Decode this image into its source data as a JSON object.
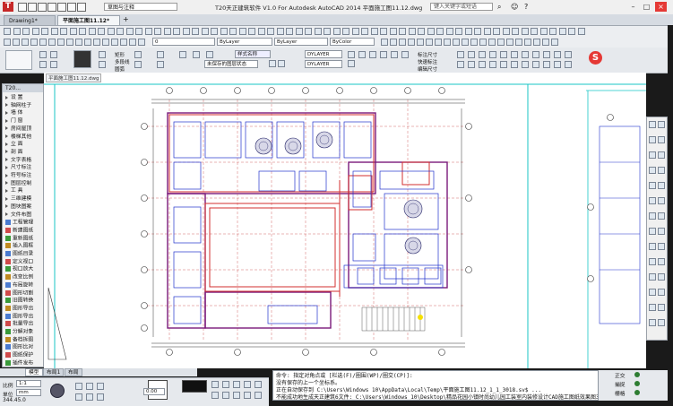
{
  "app": {
    "title": "T20天正建筑软件 V1.0 For Autodesk AutoCAD 2014     平面施工图11.12.dwg",
    "workspace": "草图与注释",
    "search_placeholder": "键入关键字或短语",
    "brand_color": "#c62828"
  },
  "doc_tabs": [
    {
      "label": "Drawing1*",
      "active": false
    },
    {
      "label": "平面施工图11.12*",
      "active": true
    }
  ],
  "toolbar": {
    "layer_name": "0",
    "linetype": "ByLayer",
    "lineweight": "ByLayer",
    "color": "ByColor",
    "style_combo": "样式名称",
    "dim_style_1": "DYLAYER",
    "dim_style_2": "DYLAYER",
    "layer_state": "未保存的图层状态"
  },
  "ribbon": {
    "labels": [
      "矩形",
      "多段线",
      "圆弧",
      "修剪",
      "延伸",
      "复制",
      "镜像",
      "缩放"
    ],
    "right_labels": [
      "标注尺寸",
      "快速标注",
      "编辑尺寸"
    ]
  },
  "viewport": {
    "label": "平面施工图11.12.dwg"
  },
  "sidebar": {
    "header": "T20...",
    "items": [
      {
        "label": "设  置",
        "kind": "arrow"
      },
      {
        "label": "轴网柱子",
        "kind": "arrow"
      },
      {
        "label": "墙  体",
        "kind": "arrow"
      },
      {
        "label": "门  窗",
        "kind": "arrow"
      },
      {
        "label": "房间屋顶",
        "kind": "arrow"
      },
      {
        "label": "楼梯其他",
        "kind": "arrow"
      },
      {
        "label": "立  面",
        "kind": "arrow"
      },
      {
        "label": "剖  面",
        "kind": "arrow"
      },
      {
        "label": "文字表格",
        "kind": "arrow"
      },
      {
        "label": "尺寸标注",
        "kind": "arrow"
      },
      {
        "label": "符号标注",
        "kind": "arrow"
      },
      {
        "label": "图层控制",
        "kind": "arrow"
      },
      {
        "label": "工  具",
        "kind": "arrow"
      },
      {
        "label": "三维建模",
        "kind": "arrow"
      },
      {
        "label": "图块图案",
        "kind": "arrow"
      },
      {
        "label": "文件布图",
        "kind": "arrow"
      },
      {
        "label": "工程管理",
        "kind": "icon"
      },
      {
        "label": "新建图纸",
        "kind": "icon"
      },
      {
        "label": "重新图纸",
        "kind": "icon"
      },
      {
        "label": "插入图框",
        "kind": "icon"
      },
      {
        "label": "图纸目录",
        "kind": "icon"
      },
      {
        "label": "定义视口",
        "kind": "icon"
      },
      {
        "label": "视口放大",
        "kind": "icon"
      },
      {
        "label": "改变比例",
        "kind": "icon"
      },
      {
        "label": "布局旋转",
        "kind": "icon"
      },
      {
        "label": "图形切割",
        "kind": "icon"
      },
      {
        "label": "旧图转换",
        "kind": "icon"
      },
      {
        "label": "图形导出",
        "kind": "icon"
      },
      {
        "label": "图形导出",
        "kind": "icon"
      },
      {
        "label": "批量导出",
        "kind": "icon"
      },
      {
        "label": "分解对象",
        "kind": "icon"
      },
      {
        "label": "备档拆图",
        "kind": "icon"
      },
      {
        "label": "图形比对",
        "kind": "icon"
      },
      {
        "label": "图纸保护",
        "kind": "icon"
      },
      {
        "label": "插件发布",
        "kind": "icon"
      }
    ]
  },
  "layout_tabs": [
    {
      "label": "模型",
      "active": true
    },
    {
      "label": "布局1",
      "active": false
    },
    {
      "label": "布局",
      "active": false
    }
  ],
  "status": {
    "scale_label": "比例",
    "scale_value": "1:1",
    "unit_label": "单位",
    "unit_value": "mm",
    "elev_value": "0.00",
    "coord": "344.45.0",
    "right_labels": [
      "正交",
      "捕捉",
      "栅格"
    ]
  },
  "command": {
    "lines": [
      "命令: 指定对角点或 [栏选(F)/圈围(WP)/圈交(CP)]:",
      "没有保存的上一个坐标系。",
      "正在自动保存到 C:\\Users\\Windows 10\\AppData\\Local\\Temp\\平面施工图11.12_1_1_3018.sv$ ...",
      "不能成功地生成天正建筑6文件: C:\\Users\\Windows 10\\Desktop\\精品花园小镇时尚幼儿园工装室内装修设计CAD施工图纸效果图3"
    ]
  }
}
